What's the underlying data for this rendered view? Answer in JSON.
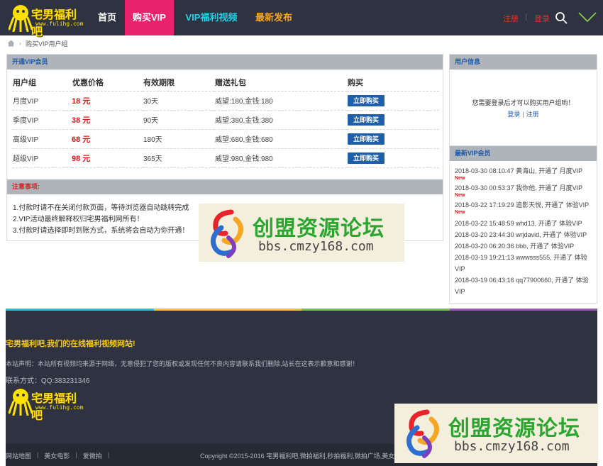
{
  "site": {
    "name": "宅男福利吧",
    "url": "www.fulihg.com"
  },
  "nav": {
    "home": "首页",
    "buy_vip": "购买VIP",
    "vip_video": "VIP福利视频",
    "new_post": "最新发布"
  },
  "header_actions": {
    "register": "注册",
    "separator": "|",
    "login": "登录",
    "search_icon": "search-icon",
    "menu_icon": "chevron-down-icon"
  },
  "breadcrumb": {
    "current": "购买VIP用户组"
  },
  "vip_panel": {
    "title": "开通VIP会员",
    "columns": [
      "用户组",
      "优惠价格",
      "有效期限",
      "赠送礼包",
      "购买"
    ],
    "rows": [
      {
        "group": "月度VIP",
        "price": "18 元",
        "period": "30天",
        "gift": "威望:180,金钱:180",
        "button": "立即购买"
      },
      {
        "group": "季度VIP",
        "price": "38 元",
        "period": "90天",
        "gift": "威望:380,金钱:380",
        "button": "立即购买"
      },
      {
        "group": "高级VIP",
        "price": "68 元",
        "period": "180天",
        "gift": "威望:680,金钱:680",
        "button": "立即购买"
      },
      {
        "group": "超级VIP",
        "price": "98 元",
        "period": "365天",
        "gift": "威望:980,金钱:980",
        "button": "立即购买"
      }
    ]
  },
  "notice": {
    "title": "注意事项:",
    "items": [
      "1.付款时请不在关闭付款页面，等待浏览器自动跳转完成",
      "2.VIP活动最终解释权归宅男福利网所有！",
      "3.付款时请选择即时到账方式，系统将会自动为你开通！"
    ]
  },
  "user_info": {
    "title": "用户信息",
    "message": "您需要登录后才可以购买用户组哟！",
    "login": "登录",
    "separator": "|",
    "register": "注册"
  },
  "latest_vip": {
    "title": "最新VIP会员",
    "new_label": "New",
    "items": [
      {
        "text": "2018-03-30 08:10:47 黄海山, 开通了 月度VIP",
        "is_new": true
      },
      {
        "text": "2018-03-30 00:53:37 我你他, 开通了 月度VIP",
        "is_new": true
      },
      {
        "text": "2018-03-22 17:19:29 追影天悦, 开通了 体验VIP",
        "is_new": true
      },
      {
        "text": "2018-03-22 15:48:59 whd13, 开通了 体验VIP",
        "is_new": false
      },
      {
        "text": "2018-03-20 23:44:30 wrjdavid, 开通了 体验VIP",
        "is_new": false
      },
      {
        "text": "2018-03-20 06:20:36 bbb, 开通了 体验VIP",
        "is_new": false
      },
      {
        "text": "2018-03-19 19:21:13 wwwsss555, 开通了 体验VIP",
        "is_new": false
      },
      {
        "text": "2018-03-19 06:43:16 qq77900660, 开通了 体验VIP",
        "is_new": false
      }
    ]
  },
  "watermark": {
    "title": "创盟资源论坛",
    "url": "bbs.cmzy168.com"
  },
  "footer": {
    "slogan": "宅男福利吧,我们的在线福利视频网站!",
    "disclaimer": "本站声明：本站所有视频均来源于网络，无意侵犯了您的版权或发现任何不良内容请联系我们删除,站长在这表示歉意和感谢！",
    "contact": "联系方式：QQ:383231346",
    "links": [
      "网站地图",
      "美女电影",
      "爱微拍"
    ],
    "copyright": "Copyright   ©2015-2016  宅男福利吧,微拍福利,秒拍福利,微拍广场,美女"
  },
  "colors": {
    "header_bg": "#2f3341",
    "accent_pink": "#e8236b",
    "accent_cyan": "#22d1e8",
    "accent_orange": "#f5a623",
    "price_red": "#e3161c",
    "button_blue": "#1f5ea8",
    "strip": [
      "#22c0e8",
      "#f5c518",
      "#7ac143",
      "#9b59b6"
    ]
  }
}
